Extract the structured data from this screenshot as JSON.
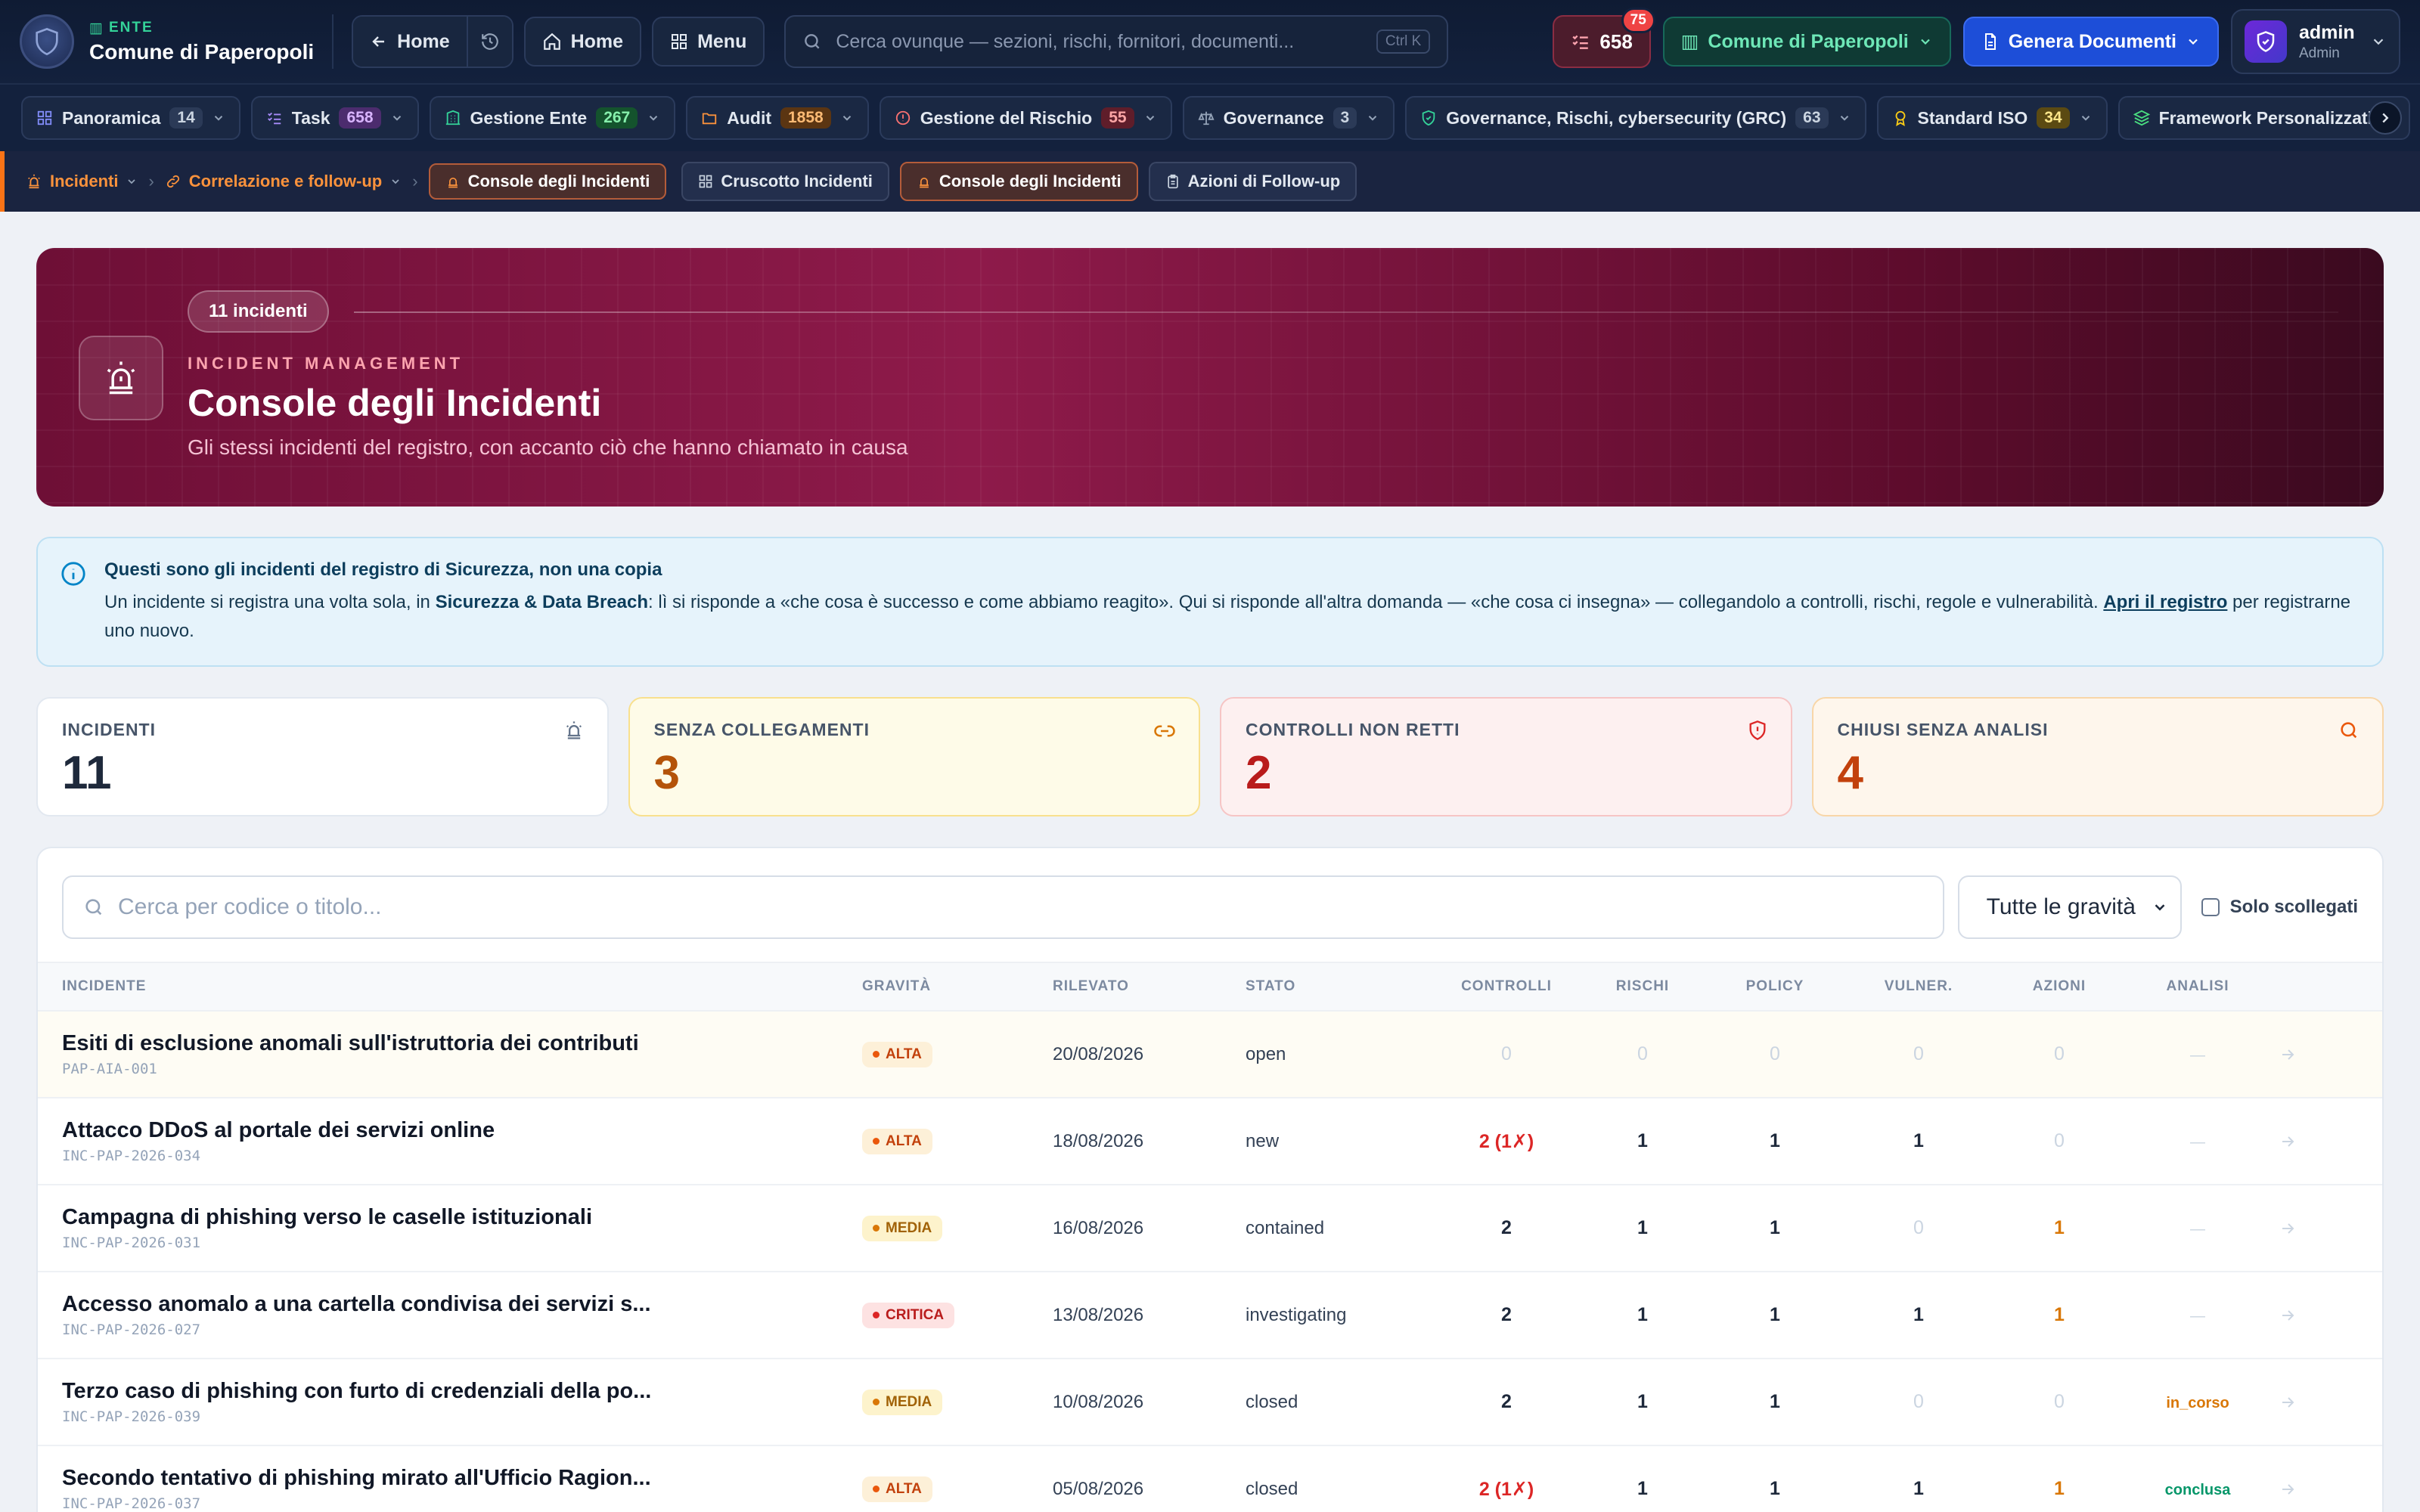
{
  "topbar": {
    "ente_label": "ENTE",
    "ente_name": "Comune di Paperopoli",
    "back_label": "Home",
    "home_label": "Home",
    "menu_label": "Menu",
    "search_placeholder": "Cerca ovunque — sezioni, rischi, fornitori, documenti...",
    "search_shortcut": "Ctrl K",
    "task_count": "658",
    "task_badge": "75",
    "ente_selector": "Comune di Paperopoli",
    "generate_label": "Genera Documenti",
    "user_name": "admin",
    "user_role": "Admin"
  },
  "modules": [
    {
      "label": "Panoramica",
      "count": "14",
      "icon": "grid-icon",
      "color": "#818cf8"
    },
    {
      "label": "Task",
      "count": "658",
      "icon": "list-check-icon",
      "color": "#a78bfa"
    },
    {
      "label": "Gestione Ente",
      "count": "267",
      "icon": "building-icon",
      "color": "#34d399"
    },
    {
      "label": "Audit",
      "count": "1858",
      "icon": "folder-icon",
      "color": "#fb923c"
    },
    {
      "label": "Gestione del Rischio",
      "count": "55",
      "icon": "alert-circle-icon",
      "color": "#f87171"
    },
    {
      "label": "Governance",
      "count": "3",
      "icon": "scale-icon",
      "color": "#94a3b8"
    },
    {
      "label": "Governance, Rischi, cybersecurity (GRC)",
      "count": "63",
      "icon": "shield-check-icon",
      "color": "#34d399"
    },
    {
      "label": "Standard ISO",
      "count": "34",
      "icon": "award-icon",
      "color": "#facc15"
    },
    {
      "label": "Framework Personalizzati",
      "count": "",
      "icon": "layers-icon",
      "color": "#4ade80"
    }
  ],
  "breadcrumb": {
    "level1": "Incidenti",
    "level2": "Correlazione e follow-up",
    "current": "Console degli Incidenti",
    "tabs": [
      "Cruscotto Incidenti",
      "Console degli Incidenti",
      "Azioni di Follow-up"
    ]
  },
  "hero": {
    "pill": "11 incidenti",
    "eyebrow": "INCIDENT MANAGEMENT",
    "title": "Console degli Incidenti",
    "subtitle": "Gli stessi incidenti del registro, con accanto ciò che hanno chiamato in causa"
  },
  "info": {
    "title": "Questi sono gli incidenti del registro di Sicurezza, non una copia",
    "text_a": "Un incidente si registra una volta sola, in ",
    "text_bold": "Sicurezza & Data Breach",
    "text_b": ": lì si risponde a «che cosa è successo e come abbiamo reagito». Qui si risponde all'altra domanda — «che cosa ci insegna» — collegandolo a controlli, rischi, regole e vulnerabilità. ",
    "link": "Apri il registro",
    "text_c": " per registrarne uno nuovo."
  },
  "stats": [
    {
      "label": "INCIDENTI",
      "value": "11",
      "color": "#1e293b"
    },
    {
      "label": "SENZA COLLEGAMENTI",
      "value": "3",
      "color": "#b45309"
    },
    {
      "label": "CONTROLLI NON RETTI",
      "value": "2",
      "color": "#b91c1c"
    },
    {
      "label": "CHIUSI SENZA ANALISI",
      "value": "4",
      "color": "#c2410c"
    }
  ],
  "filters": {
    "search_placeholder": "Cerca per codice o titolo...",
    "severity_select": "Tutte le gravità",
    "only_unlinked": "Solo scollegati"
  },
  "table": {
    "headers": [
      "INCIDENTE",
      "GRAVITÀ",
      "RILEVATO",
      "STATO",
      "CONTROLLI",
      "RISCHI",
      "POLICY",
      "VULNER.",
      "AZIONI",
      "ANALISI"
    ],
    "rows": [
      {
        "title": "Esiti di esclusione anomali sull'istruttoria dei contributi",
        "code": "PAP-AIA-001",
        "severity": "ALTA",
        "sev": "alta",
        "date": "20/08/2026",
        "status": "open",
        "controls": "0",
        "risks": "0",
        "policy": "0",
        "vuln": "0",
        "actions": "0",
        "analysis": "—"
      },
      {
        "title": "Attacco DDoS al portale dei servizi online",
        "code": "INC-PAP-2026-034",
        "severity": "ALTA",
        "sev": "alta",
        "date": "18/08/2026",
        "status": "new",
        "controls": "2 (1✗)",
        "risks": "1",
        "policy": "1",
        "vuln": "1",
        "actions": "0",
        "analysis": "—"
      },
      {
        "title": "Campagna di phishing verso le caselle istituzionali",
        "code": "INC-PAP-2026-031",
        "severity": "MEDIA",
        "sev": "media",
        "date": "16/08/2026",
        "status": "contained",
        "controls": "2",
        "risks": "1",
        "policy": "1",
        "vuln": "0",
        "actions": "1",
        "analysis": "—"
      },
      {
        "title": "Accesso anomalo a una cartella condivisa dei servizi s...",
        "code": "INC-PAP-2026-027",
        "severity": "CRITICA",
        "sev": "critica",
        "date": "13/08/2026",
        "status": "investigating",
        "controls": "2",
        "risks": "1",
        "policy": "1",
        "vuln": "1",
        "actions": "1",
        "analysis": "—"
      },
      {
        "title": "Terzo caso di phishing con furto di credenziali della po...",
        "code": "INC-PAP-2026-039",
        "severity": "MEDIA",
        "sev": "media",
        "date": "10/08/2026",
        "status": "closed",
        "controls": "2",
        "risks": "1",
        "policy": "1",
        "vuln": "0",
        "actions": "0",
        "analysis": "in_corso"
      },
      {
        "title": "Secondo tentativo di phishing mirato all'Ufficio Ragion...",
        "code": "INC-PAP-2026-037",
        "severity": "ALTA",
        "sev": "alta",
        "date": "05/08/2026",
        "status": "closed",
        "controls": "2 (1✗)",
        "risks": "1",
        "policy": "1",
        "vuln": "1",
        "actions": "1",
        "analysis": "conclusa"
      }
    ]
  },
  "colors": {
    "accent": "#1d4ed8",
    "hero": "#8e1a4a",
    "danger": "#dc2626",
    "warning": "#d97706",
    "success": "#059669"
  }
}
